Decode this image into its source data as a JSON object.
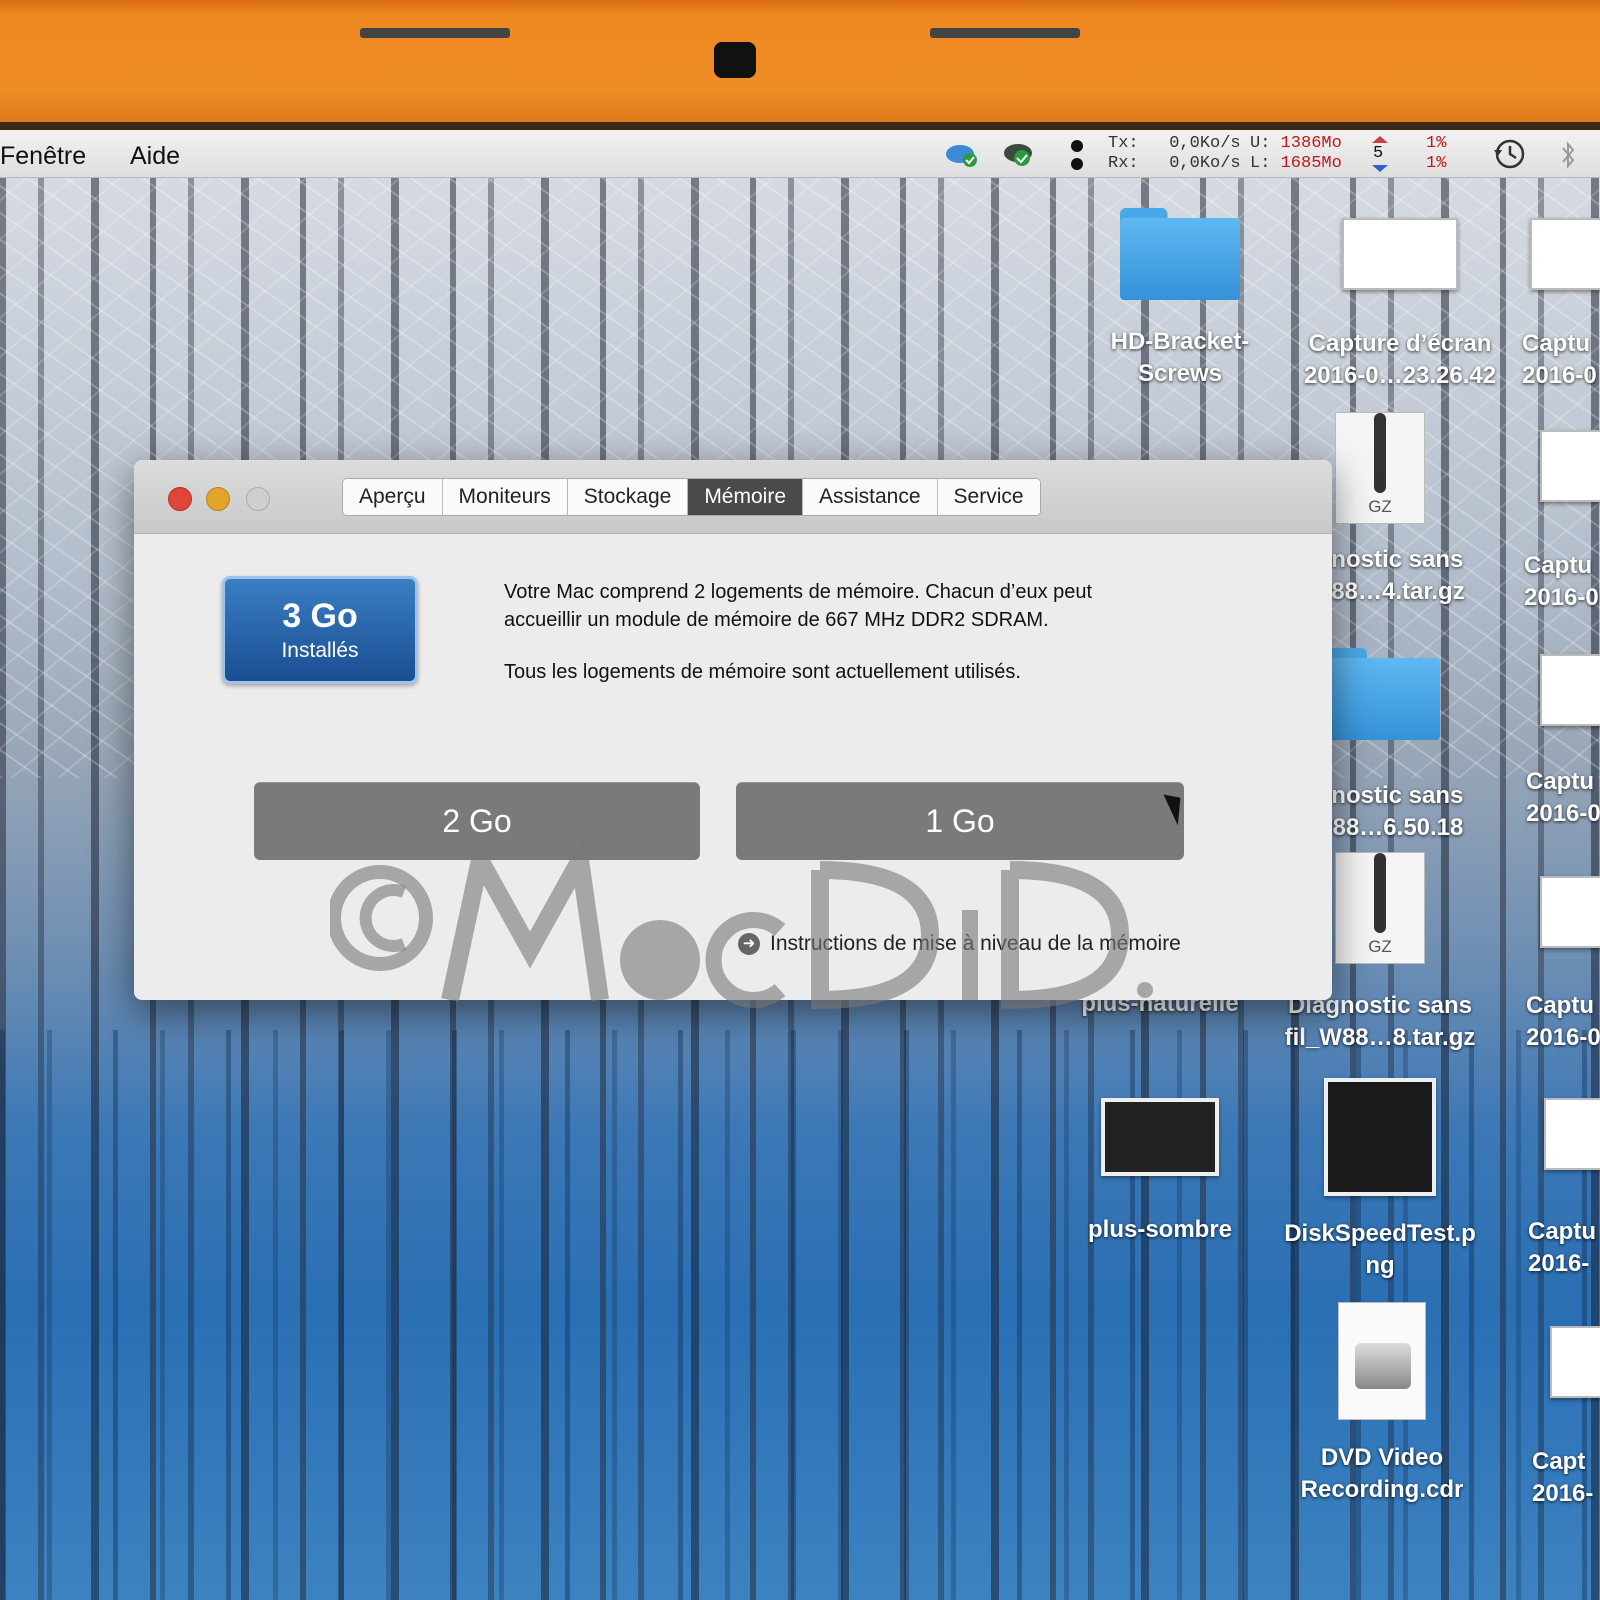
{
  "menubar": {
    "items": [
      "Fenêtre",
      "Aide"
    ],
    "netmon": {
      "tx_label": "Tx:",
      "tx_value": "0,0Ko/s",
      "rx_label": "Rx:",
      "rx_value": "0,0Ko/s",
      "used_label": "U:",
      "used_value": "1386Mo",
      "free_label": "L:",
      "free_value": "1685Mo",
      "count": "5",
      "cpu_top": "1%",
      "cpu_bottom": "1%"
    }
  },
  "desktop": {
    "icons": [
      {
        "label": "HD-Bracket-\nScrews"
      },
      {
        "label": "Capture d’écran\n2016-0…23.26.42"
      },
      {
        "label": "Captu\n2016-0"
      },
      {
        "label": "iagnostic sans\n_W88…4.tar.gz"
      },
      {
        "label": "Captu\n2016-0"
      },
      {
        "label": "iagnostic sans\n_W88…6.50.18"
      },
      {
        "label": "Captu\n2016-0"
      },
      {
        "label": "plus-naturelle"
      },
      {
        "label": "Diagnostic sans\nfil_W88…8.tar.gz"
      },
      {
        "label": "Captu\n2016-0"
      },
      {
        "label": "plus-sombre"
      },
      {
        "label": "DiskSpeedTest.p\nng"
      },
      {
        "label": "Captu\n2016-"
      },
      {
        "label": "DVD Video\nRecording.cdr"
      },
      {
        "label": "Capt\n2016-"
      }
    ],
    "gz_label": "GZ"
  },
  "window": {
    "tabs": [
      "Aperçu",
      "Moniteurs",
      "Stockage",
      "Mémoire",
      "Assistance",
      "Service"
    ],
    "active_tab": "Mémoire",
    "badge": {
      "size": "3 Go",
      "caption": "Installés"
    },
    "description_1": "Votre Mac comprend 2 logements de mémoire. Chacun d’eux peut accueillir un module de mémoire de 667 MHz DDR2 SDRAM.",
    "description_2": "Tous les logements de mémoire sont actuellement utilisés.",
    "slots": [
      "2 Go",
      "1 Go"
    ],
    "link": "Instructions de mise à niveau de la mémoire"
  },
  "watermark": "©MacDid.FR",
  "colors": {
    "bezel": "#f08c24",
    "active_tab": "#4a4a4a",
    "badge": "#1a4e92",
    "slot": "#7a7a7a"
  }
}
